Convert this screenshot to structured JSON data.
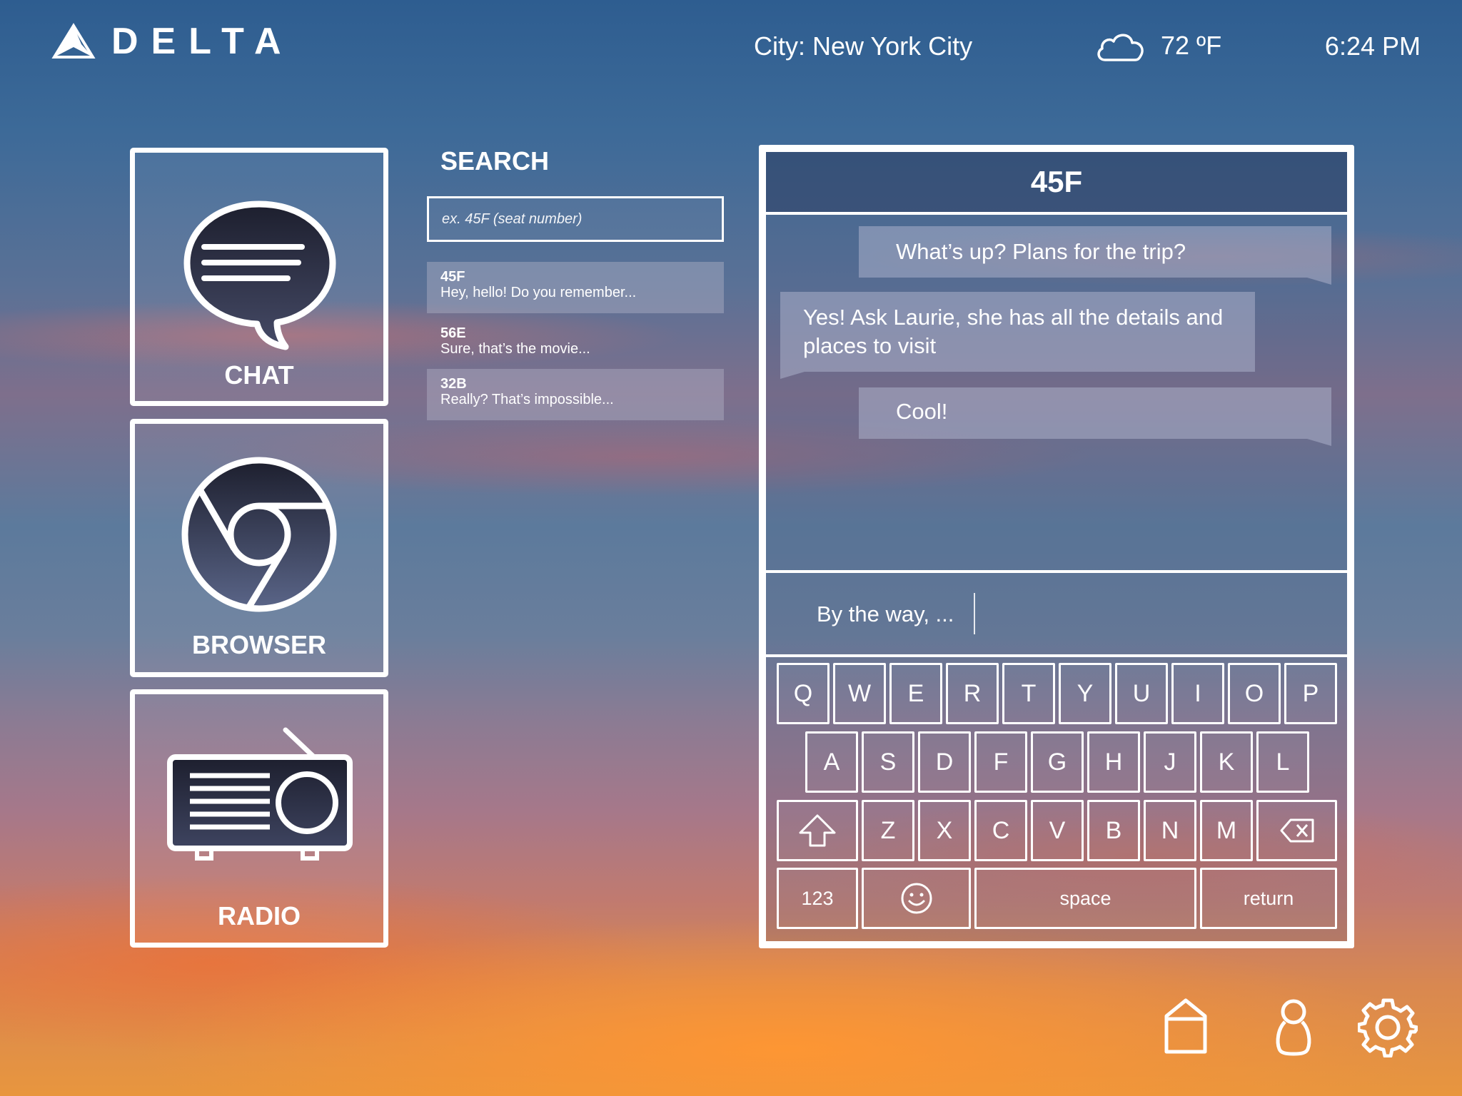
{
  "header": {
    "brand": "DELTA",
    "city": "City: New York City",
    "temperature": "72 ºF",
    "time": "6:24 PM",
    "weather_icon": "cloud-icon"
  },
  "apps": [
    {
      "label": "CHAT",
      "icon": "chat-bubble-icon"
    },
    {
      "label": "BROWSER",
      "icon": "browser-icon"
    },
    {
      "label": "RADIO",
      "icon": "radio-icon"
    }
  ],
  "search": {
    "title": "SEARCH",
    "placeholder": "ex. 45F (seat number)",
    "results": [
      {
        "seat": "45F",
        "preview": "Hey, hello! Do you remember..."
      },
      {
        "seat": "56E",
        "preview": "Sure, that’s the movie..."
      },
      {
        "seat": "32B",
        "preview": "Really? That’s impossible..."
      }
    ]
  },
  "chat": {
    "title": "45F",
    "messages": [
      {
        "text": "What’s up? Plans for the trip?",
        "side": "right"
      },
      {
        "text": "Yes! Ask Laurie, she has all the details and places to visit",
        "side": "left"
      },
      {
        "text": "Cool!",
        "side": "right"
      }
    ],
    "compose_text": "By the way, ..."
  },
  "keyboard": {
    "row1": [
      "Q",
      "W",
      "E",
      "R",
      "T",
      "Y",
      "U",
      "I",
      "O",
      "P"
    ],
    "row2": [
      "A",
      "S",
      "D",
      "F",
      "G",
      "H",
      "J",
      "K",
      "L"
    ],
    "row3": [
      "Z",
      "X",
      "C",
      "V",
      "B",
      "N",
      "M"
    ],
    "shift_icon": "shift-icon",
    "backspace_icon": "backspace-icon",
    "numbers": "123",
    "emoji_icon": "smiley-icon",
    "space": "space",
    "return": "return"
  },
  "bottom_bar": [
    "home-icon",
    "profile-icon",
    "gear-icon"
  ]
}
